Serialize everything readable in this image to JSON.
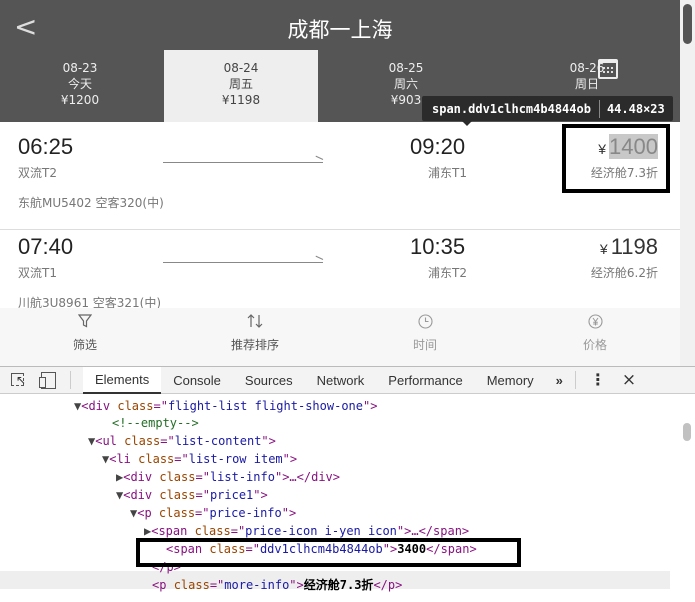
{
  "header": {
    "back_glyph": "<",
    "title": "成都一上海"
  },
  "dates": [
    {
      "date": "08-23",
      "weekday": "今天",
      "price": "¥1200"
    },
    {
      "date": "08-24",
      "weekday": "周五",
      "price": "¥1198",
      "selected": true
    },
    {
      "date": "08-25",
      "weekday": "周六",
      "price": "¥903"
    },
    {
      "date": "08-26",
      "weekday": "周日",
      "price": ""
    }
  ],
  "tooltip": {
    "selector": "span.ddv1clhcm4b4844ob",
    "size": "44.48×23"
  },
  "flights": [
    {
      "dep_time": "06:25",
      "dep_airport": "双流T2",
      "arr_time": "09:20",
      "arr_airport": "浦东T1",
      "currency": "¥",
      "price": "1400",
      "discount": "经济舱7.3折",
      "airline": "东航MU5402 空客320(中)"
    },
    {
      "dep_time": "07:40",
      "dep_airport": "双流T1",
      "arr_time": "10:35",
      "arr_airport": "浦东T2",
      "currency": "¥",
      "price": "1198",
      "discount": "经济舱6.2折",
      "airline": "川航3U8961 空客321(中)"
    }
  ],
  "filterbar": [
    {
      "icon": "filter-icon",
      "label": "筛选"
    },
    {
      "icon": "sort-icon",
      "label": "推荐排序"
    },
    {
      "icon": "clock-icon",
      "label": "时间"
    },
    {
      "icon": "yen-icon",
      "label": "价格"
    }
  ],
  "devtools": {
    "tabs": [
      "Elements",
      "Console",
      "Sources",
      "Network",
      "Performance",
      "Memory"
    ],
    "active_tab": "Elements",
    "more": "»",
    "kebab": "⋮",
    "close": "×",
    "dom": [
      {
        "indent": 86,
        "tri": "▼",
        "parts": [
          [
            "tag",
            "<div "
          ],
          [
            "attr",
            "class"
          ],
          [
            "tag",
            "=\""
          ],
          [
            "val",
            "flight-list flight-show-one"
          ],
          [
            "tag",
            "\">"
          ]
        ]
      },
      {
        "indent": 112,
        "tri": "",
        "parts": [
          [
            "cmt",
            "<!--empty-->"
          ]
        ]
      },
      {
        "indent": 100,
        "tri": "▼",
        "parts": [
          [
            "tag",
            "<ul "
          ],
          [
            "attr",
            "class"
          ],
          [
            "tag",
            "=\""
          ],
          [
            "val",
            "list-content"
          ],
          [
            "tag",
            "\">"
          ]
        ]
      },
      {
        "indent": 114,
        "tri": "▼",
        "parts": [
          [
            "tag",
            "<li "
          ],
          [
            "attr",
            "class"
          ],
          [
            "tag",
            "=\""
          ],
          [
            "val",
            "list-row item"
          ],
          [
            "tag",
            "\">"
          ]
        ]
      },
      {
        "indent": 128,
        "tri": "▶",
        "parts": [
          [
            "tag",
            "<div "
          ],
          [
            "attr",
            "class"
          ],
          [
            "tag",
            "=\""
          ],
          [
            "val",
            "list-info"
          ],
          [
            "tag",
            "\">…</div>"
          ]
        ]
      },
      {
        "indent": 128,
        "tri": "▼",
        "parts": [
          [
            "tag",
            "<div "
          ],
          [
            "attr",
            "class"
          ],
          [
            "tag",
            "=\""
          ],
          [
            "val",
            "price1"
          ],
          [
            "tag",
            "\">"
          ]
        ]
      },
      {
        "indent": 142,
        "tri": "▼",
        "parts": [
          [
            "tag",
            "<p "
          ],
          [
            "attr",
            "class"
          ],
          [
            "tag",
            "=\""
          ],
          [
            "val",
            "price-info"
          ],
          [
            "tag",
            "\">"
          ]
        ]
      },
      {
        "indent": 156,
        "tri": "▶",
        "parts": [
          [
            "tag",
            "<span "
          ],
          [
            "attr",
            "class"
          ],
          [
            "tag",
            "=\""
          ],
          [
            "val",
            "price-icon i-yen icon"
          ],
          [
            "tag",
            "\">…</span>"
          ]
        ]
      },
      {
        "indent": 166,
        "tri": "",
        "parts": [
          [
            "tag",
            "<span "
          ],
          [
            "attr",
            "class"
          ],
          [
            "tag",
            "=\""
          ],
          [
            "val",
            "ddv1clhcm4b4844ob"
          ],
          [
            "tag",
            "\">"
          ],
          [
            "txt",
            "3400"
          ],
          [
            "tag",
            "</span>"
          ]
        ]
      },
      {
        "indent": 152,
        "tri": "",
        "parts": [
          [
            "tag",
            "</p>"
          ]
        ]
      },
      {
        "indent": 152,
        "tri": "",
        "parts": [
          [
            "tag",
            "<p "
          ],
          [
            "attr",
            "class"
          ],
          [
            "tag",
            "=\""
          ],
          [
            "val",
            "more-info"
          ],
          [
            "tag",
            "\">"
          ],
          [
            "txt",
            "经济舱7.3折"
          ],
          [
            "tag",
            "</p>"
          ]
        ]
      }
    ]
  }
}
